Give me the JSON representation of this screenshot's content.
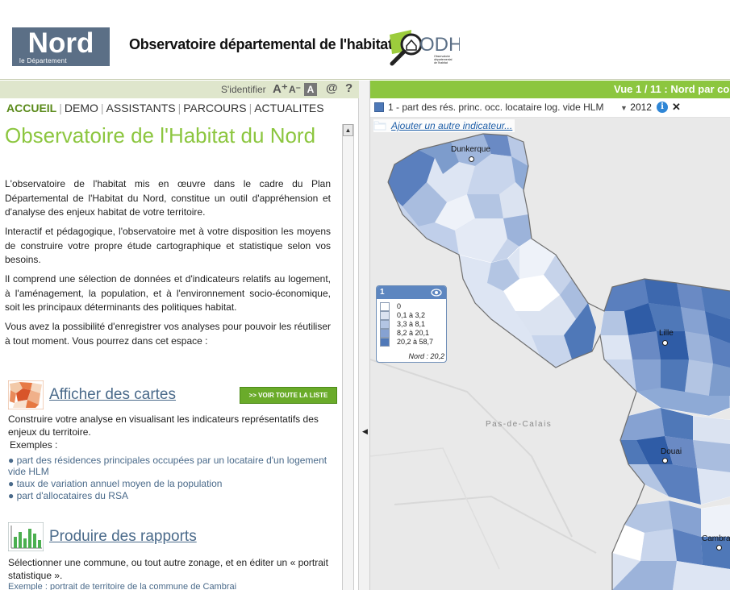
{
  "header": {
    "nord_logo_big": "Nord",
    "nord_logo_small": "le Département",
    "title": "Observatoire départemental de l'habitat",
    "odh_logo_text": "ODH",
    "odh_logo_sub": "Observatoire départemental de l'habitat"
  },
  "toolbar": {
    "identify": "S'identifier",
    "font_plus": "A⁺",
    "font_minus": "A⁻",
    "contrast": "A",
    "at": "@",
    "help": "?"
  },
  "nav": {
    "items": [
      "ACCUEIL",
      "DEMO",
      "ASSISTANTS",
      "PARCOURS",
      "ACTUALITES"
    ]
  },
  "content": {
    "title": "Observatoire de l'Habitat du Nord",
    "p1": "L'observatoire de l'habitat mis en œuvre dans le cadre du Plan Départemental de l'Habitat du Nord, constitue un outil d'appréhension et d'analyse des enjeux habitat de votre territoire.",
    "p2": "Interactif et pédagogique, l'observatoire met à votre disposition les moyens de construire votre propre étude cartographique et statistique selon vos besoins.",
    "p3": "Il comprend une sélection de données et d'indicateurs relatifs au logement, à l'aménagement, la population, et à l'environnement socio-économique, soit les principaux déterminants des politiques habitat.",
    "p4": "Vous avez la possibilité d'enregistrer vos analyses pour pouvoir les réutiliser à tout moment. Vous pourrez dans cet espace :"
  },
  "section_maps": {
    "title": "Afficher des cartes",
    "button": ">> VOIR TOUTE LA LISTE",
    "desc": "Construire votre analyse en visualisant les indicateurs représentatifs des enjeux du territoire.",
    "examples_label": "Exemples :",
    "examples": [
      "● part des résidences principales occupées par un locataire d'un logement vide HLM",
      "● taux de variation annuel moyen de la population",
      "● part d'allocataires du RSA"
    ]
  },
  "section_reports": {
    "title": "Produire des rapports",
    "desc": "Sélectionner une commune, ou tout autre zonage, et en éditer un « portrait statistique ».",
    "example": "Exemple : portrait de territoire de la commune de Cambrai"
  },
  "map": {
    "view_bar": "Vue 1 / 11 : Nord par co",
    "indicator_label": "1 - part des rés. princ. occ. locataire log. vide HLM",
    "year": "2012",
    "add_indicator": "Ajouter un autre indicateur...",
    "cities": [
      "Dunkerque",
      "Lille",
      "Douai",
      "Cambra"
    ],
    "region_label": "Pas-de-Calais",
    "legend": {
      "id": "1",
      "classes": [
        {
          "label": "0",
          "color": "#ffffff"
        },
        {
          "label": "0,1 à 3,2",
          "color": "#dbe3f1"
        },
        {
          "label": "3,3 à 8,1",
          "color": "#b3c5e3"
        },
        {
          "label": "8,2 à 20,1",
          "color": "#86a2d2"
        },
        {
          "label": "20,2 à 58,7",
          "color": "#4f78b8"
        }
      ],
      "footer": "Nord : 20,2"
    }
  },
  "colors": {
    "accent_green": "#8cc63f",
    "link_blue": "#4a6a8a",
    "nord_blue": "#5b6f86"
  }
}
